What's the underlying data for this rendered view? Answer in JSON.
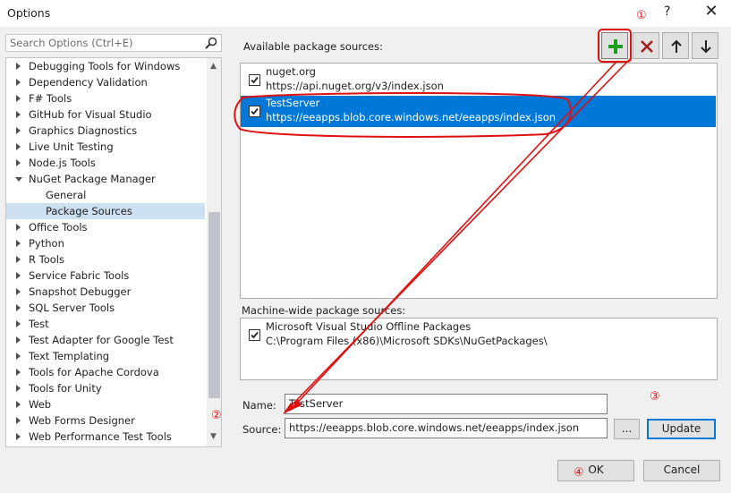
{
  "window": {
    "title": "Options",
    "help_label": "?",
    "close_label": "✕"
  },
  "search": {
    "placeholder": "Search Options (Ctrl+E)"
  },
  "tree": {
    "items": [
      {
        "label": "Debugging Tools for Windows",
        "state": "collapsed"
      },
      {
        "label": "Dependency Validation",
        "state": "collapsed"
      },
      {
        "label": "F# Tools",
        "state": "collapsed"
      },
      {
        "label": "GitHub for Visual Studio",
        "state": "collapsed"
      },
      {
        "label": "Graphics Diagnostics",
        "state": "collapsed"
      },
      {
        "label": "Live Unit Testing",
        "state": "collapsed"
      },
      {
        "label": "Node.js Tools",
        "state": "collapsed"
      },
      {
        "label": "NuGet Package Manager",
        "state": "expanded"
      },
      {
        "label": "General",
        "state": "child"
      },
      {
        "label": "Package Sources",
        "state": "child-selected"
      },
      {
        "label": "Office Tools",
        "state": "collapsed"
      },
      {
        "label": "Python",
        "state": "collapsed"
      },
      {
        "label": "R Tools",
        "state": "collapsed"
      },
      {
        "label": "Service Fabric Tools",
        "state": "collapsed"
      },
      {
        "label": "Snapshot Debugger",
        "state": "collapsed"
      },
      {
        "label": "SQL Server Tools",
        "state": "collapsed"
      },
      {
        "label": "Test",
        "state": "collapsed"
      },
      {
        "label": "Test Adapter for Google Test",
        "state": "collapsed"
      },
      {
        "label": "Text Templating",
        "state": "collapsed"
      },
      {
        "label": "Tools for Apache Cordova",
        "state": "collapsed"
      },
      {
        "label": "Tools for Unity",
        "state": "collapsed"
      },
      {
        "label": "Web",
        "state": "collapsed"
      },
      {
        "label": "Web Forms Designer",
        "state": "collapsed"
      },
      {
        "label": "Web Performance Test Tools",
        "state": "collapsed"
      }
    ]
  },
  "available": {
    "label": "Available package sources:",
    "sources": [
      {
        "name": "nuget.org",
        "url": "https://api.nuget.org/v3/index.json",
        "checked": true,
        "selected": false
      },
      {
        "name": "TestServer",
        "url": "https://eeapps.blob.core.windows.net/eeapps/index.json",
        "checked": true,
        "selected": true
      }
    ]
  },
  "toolbar": {
    "add_icon": "plus-icon",
    "remove_icon": "x-icon",
    "up_icon": "arrow-up-icon",
    "down_icon": "arrow-down-icon"
  },
  "machine_wide": {
    "label": "Machine-wide package sources:",
    "sources": [
      {
        "name": "Microsoft Visual Studio Offline Packages",
        "url": "C:\\Program Files (x86)\\Microsoft SDKs\\NuGetPackages\\",
        "checked": true
      }
    ]
  },
  "form": {
    "name_label": "Name:",
    "name_value": "TestServer",
    "source_label": "Source:",
    "source_value": "https://eeapps.blob.core.windows.net/eeapps/index.json",
    "browse_label": "...",
    "update_label": "Update"
  },
  "footer": {
    "ok_label": "OK",
    "cancel_label": "Cancel"
  },
  "annotations": {
    "n1": "①",
    "n2": "②",
    "n3": "③",
    "n4": "④",
    "color": "#e01010"
  },
  "colors": {
    "selection": "#0078d7",
    "tree_selection": "#cce0f2",
    "add_icon": "#1e9e1e",
    "remove_icon": "#a11d1d"
  }
}
